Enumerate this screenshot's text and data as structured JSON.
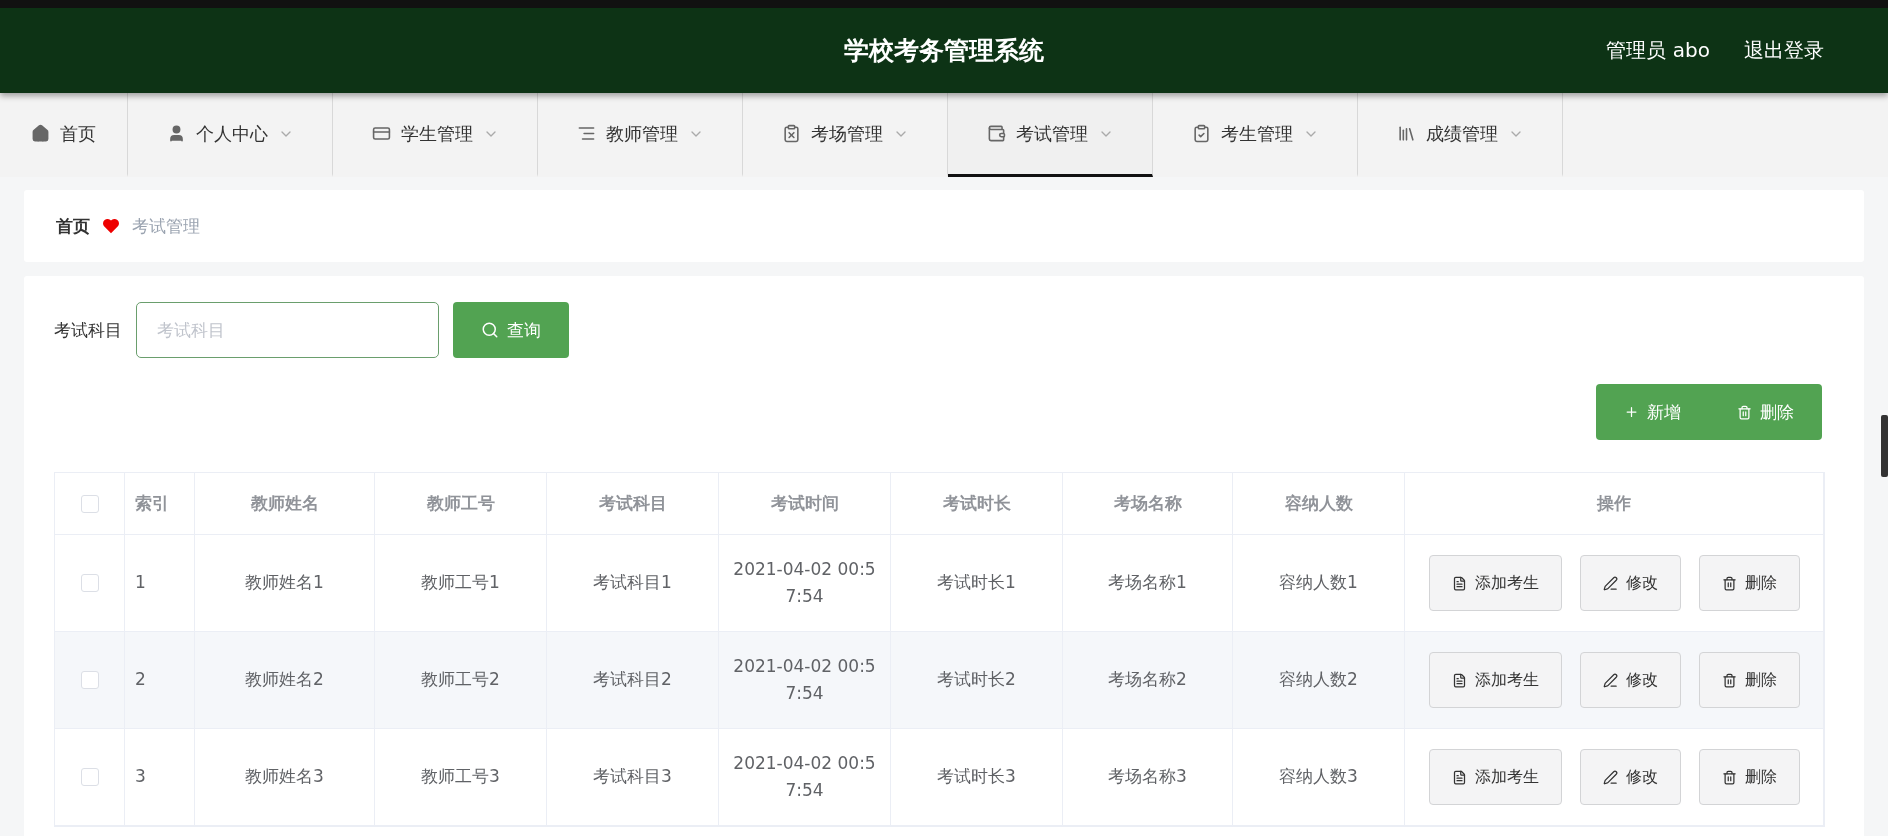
{
  "header": {
    "title": "学校考务管理系统",
    "user": "管理员 abo",
    "logout": "退出登录"
  },
  "nav": [
    {
      "label": "首页",
      "selected": false,
      "dropdown": false
    },
    {
      "label": "个人中心",
      "selected": false,
      "dropdown": true
    },
    {
      "label": "学生管理",
      "selected": false,
      "dropdown": true
    },
    {
      "label": "教师管理",
      "selected": false,
      "dropdown": true
    },
    {
      "label": "考场管理",
      "selected": false,
      "dropdown": true
    },
    {
      "label": "考试管理",
      "selected": true,
      "dropdown": true
    },
    {
      "label": "考生管理",
      "selected": false,
      "dropdown": true
    },
    {
      "label": "成绩管理",
      "selected": false,
      "dropdown": true
    }
  ],
  "breadcrumb": {
    "home": "首页",
    "current": "考试管理"
  },
  "search": {
    "label": "考试科目",
    "placeholder": "考试科目",
    "button": "查询"
  },
  "actions": {
    "add": "新增",
    "delete": "删除"
  },
  "table": {
    "select_all_checked": false,
    "columns": [
      "索引",
      "教师姓名",
      "教师工号",
      "考试科目",
      "考试时间",
      "考试时长",
      "考场名称",
      "容纳人数",
      "操作"
    ],
    "rows": [
      {
        "checked": false,
        "cells": [
          "1",
          "教师姓名1",
          "教师工号1",
          "考试科目1",
          "2021-04-02 00:57:54",
          "考试时长1",
          "考场名称1",
          "容纳人数1"
        ],
        "buttons": [
          "添加考生",
          "修改",
          "删除"
        ]
      },
      {
        "checked": false,
        "cells": [
          "2",
          "教师姓名2",
          "教师工号2",
          "考试科目2",
          "2021-04-02 00:57:54",
          "考试时长2",
          "考场名称2",
          "容纳人数2"
        ],
        "buttons": [
          "添加考生",
          "修改",
          "删除"
        ]
      },
      {
        "checked": false,
        "cells": [
          "3",
          "教师姓名3",
          "教师工号3",
          "考试科目3",
          "2021-04-02 00:57:54",
          "考试时长3",
          "考场名称3",
          "容纳人数3"
        ],
        "buttons": [
          "添加考生",
          "修改",
          "删除"
        ]
      }
    ]
  }
}
